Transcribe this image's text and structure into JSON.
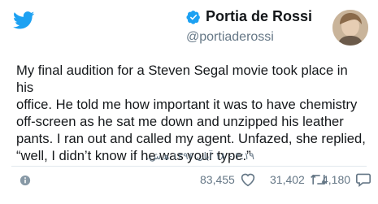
{
  "author": {
    "display_name": "Portia de Rossi",
    "handle": "@portiaderossi",
    "verified": true
  },
  "tweet": {
    "text": "My final audition for a Steven Segal movie took place in his\noffice. He told me how important it was to have chemistry\noff-screen as he sat me down and unzipped his leather\npants. I ran out and called my agent. Unfazed, she replied,\n“well, I didn’t know if he was your type.”",
    "timestamp": "۲:۱۹ - ۱۸ آبان ۱۳۹۶ ه‍.ش."
  },
  "actions": {
    "likes": "83,455",
    "retweets": "31,402",
    "replies": "4,180"
  },
  "icons": {
    "brand": "twitter-bird-icon",
    "verified": "verified-badge-icon",
    "info": "info-icon",
    "like": "heart-icon",
    "retweet": "retweet-icon",
    "reply": "reply-bubble-icon"
  },
  "colors": {
    "brand": "#1da1f2",
    "text": "#14171a",
    "muted": "#657786",
    "divider": "#e1e8ed"
  }
}
